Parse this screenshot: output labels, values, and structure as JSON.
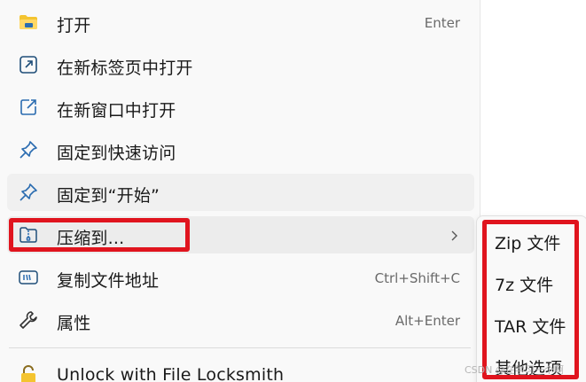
{
  "menu": {
    "items": [
      {
        "label": "打开",
        "shortcut": "Enter",
        "icon": "folder-icon"
      },
      {
        "label": "在新标签页中打开",
        "shortcut": "",
        "icon": "open-in-new-tab-icon"
      },
      {
        "label": "在新窗口中打开",
        "shortcut": "",
        "icon": "open-in-new-window-icon"
      },
      {
        "label": "固定到快速访问",
        "shortcut": "",
        "icon": "pin-icon"
      },
      {
        "label": "固定到“开始”",
        "shortcut": "",
        "icon": "pin-icon"
      },
      {
        "label": "压缩到...",
        "shortcut": "",
        "icon": "zip-folder-icon"
      },
      {
        "label": "复制文件地址",
        "shortcut": "Ctrl+Shift+C",
        "icon": "copy-path-icon"
      },
      {
        "label": "属性",
        "shortcut": "Alt+Enter",
        "icon": "wrench-icon"
      },
      {
        "label": "Unlock with File Locksmith",
        "shortcut": "",
        "icon": "lock-icon"
      }
    ]
  },
  "submenu": {
    "items": [
      "Zip 文件",
      "7z 文件",
      "TAR 文件",
      "其他选项"
    ]
  },
  "watermark": "CSDN @在学习一个啊",
  "colors": {
    "highlight": "#e0141e",
    "accent_blue": "#2b6cb0",
    "folder_yellow": "#f4c430"
  }
}
